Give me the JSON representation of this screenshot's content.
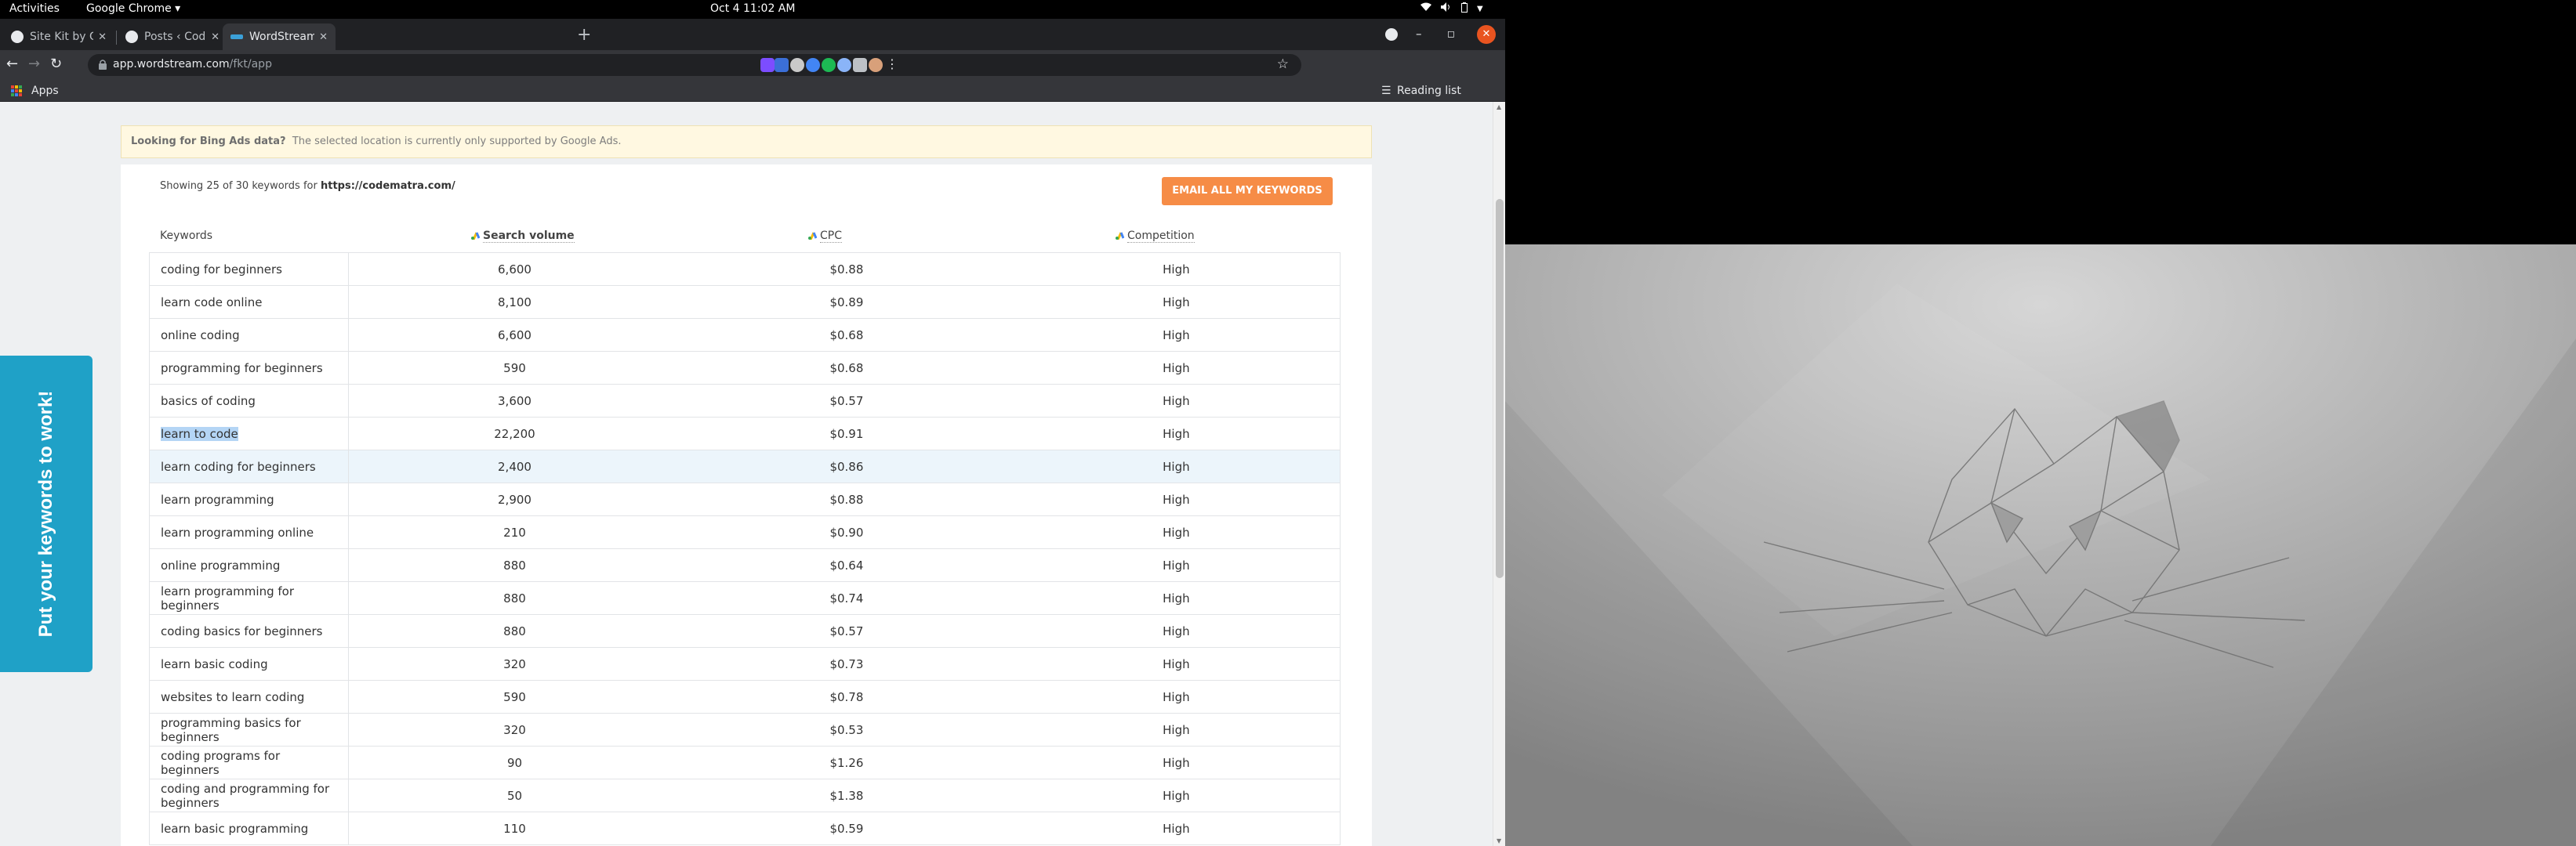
{
  "topbar": {
    "activities": "Activities",
    "app_menu": "Google Chrome ▾",
    "clock": "Oct 4  11:02 AM"
  },
  "tabs": [
    {
      "title": "Site Kit by Google Dashbo",
      "favicon_color": "#e8eaed"
    },
    {
      "title": "Posts ‹ Code Matra — Wo",
      "favicon_color": "#e8eaed"
    },
    {
      "title": "WordStream Free Keywo",
      "favicon_color": "#3ba0d8"
    }
  ],
  "omnibox": {
    "host": "app.wordstream.com",
    "path": "/fkt/app"
  },
  "bookmarks": {
    "apps": "Apps",
    "reading_list": "Reading list"
  },
  "notice": {
    "strong": "Looking for Bing Ads data?",
    "text": "The selected location is currently only supported by Google Ads."
  },
  "summary": {
    "prefix": "Showing 25 of 30 keywords for",
    "url": "https://codematra.com/"
  },
  "email_button": "EMAIL ALL MY KEYWORDS",
  "columns": {
    "keywords": "Keywords",
    "volume": "Search volume",
    "cpc": "CPC",
    "competition": "Competition"
  },
  "side_tab": "Put your keywords to work!",
  "rows": [
    {
      "keyword": "coding for beginners",
      "volume": "6,600",
      "cpc": "$0.88",
      "competition": "High"
    },
    {
      "keyword": "learn code online",
      "volume": "8,100",
      "cpc": "$0.89",
      "competition": "High"
    },
    {
      "keyword": "online coding",
      "volume": "6,600",
      "cpc": "$0.68",
      "competition": "High"
    },
    {
      "keyword": "programming for beginners",
      "volume": "590",
      "cpc": "$0.68",
      "competition": "High"
    },
    {
      "keyword": "basics of coding",
      "volume": "3,600",
      "cpc": "$0.57",
      "competition": "High"
    },
    {
      "keyword": "learn to code",
      "volume": "22,200",
      "cpc": "$0.91",
      "competition": "High"
    },
    {
      "keyword": "learn coding for beginners",
      "volume": "2,400",
      "cpc": "$0.86",
      "competition": "High"
    },
    {
      "keyword": "learn programming",
      "volume": "2,900",
      "cpc": "$0.88",
      "competition": "High"
    },
    {
      "keyword": "learn programming online",
      "volume": "210",
      "cpc": "$0.90",
      "competition": "High"
    },
    {
      "keyword": "online programming",
      "volume": "880",
      "cpc": "$0.64",
      "competition": "High"
    },
    {
      "keyword": "learn programming for beginners",
      "volume": "880",
      "cpc": "$0.74",
      "competition": "High"
    },
    {
      "keyword": "coding basics for beginners",
      "volume": "880",
      "cpc": "$0.57",
      "competition": "High"
    },
    {
      "keyword": "learn basic coding",
      "volume": "320",
      "cpc": "$0.73",
      "competition": "High"
    },
    {
      "keyword": "websites to learn coding",
      "volume": "590",
      "cpc": "$0.78",
      "competition": "High"
    },
    {
      "keyword": "programming basics for beginners",
      "volume": "320",
      "cpc": "$0.53",
      "competition": "High"
    },
    {
      "keyword": "coding programs for beginners",
      "volume": "90",
      "cpc": "$1.26",
      "competition": "High"
    },
    {
      "keyword": "coding and programming for beginners",
      "volume": "50",
      "cpc": "$1.38",
      "competition": "High"
    },
    {
      "keyword": "learn basic programming",
      "volume": "110",
      "cpc": "$0.59",
      "competition": "High"
    }
  ],
  "selected_row": 5,
  "hover_row": 6
}
